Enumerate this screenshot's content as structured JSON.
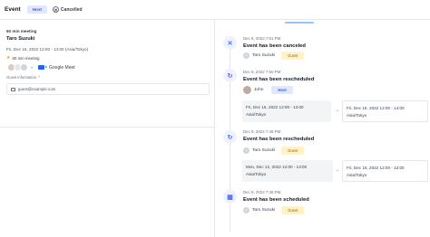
{
  "header": {
    "title": "Event",
    "badge": "Host",
    "status": "Cancelled",
    "status_icon": "cancel-circle-icon"
  },
  "details": {
    "event_name": "60 min meeting",
    "host": "Taro Suzuki",
    "time": "Fri, Dec 16, 2022 12:00 - 14:00 (Asia/Tokyo)",
    "duration": "60 min meeting",
    "location": "Google Meet",
    "guest_info_label": "Guest information",
    "guest_email": "guest@example.com"
  },
  "timeline": [
    {
      "icon": "close-icon",
      "date": "Dec 9, 2022 7:51 PM",
      "title": "Event has been canceled",
      "person": "Taro Suzuki",
      "role": "Guest"
    },
    {
      "icon": "reschedule-icon",
      "date": "Dec 9, 2022 7:50 PM",
      "title": "Event has been rescheduled",
      "person": "John",
      "role": "Host",
      "from": "Fri, Dec 16, 2022 12:00 - 13:00 · Asia/Tokyo",
      "to": "Fri, Dec 16, 2022 12:00 - 14:00 · Asia/Tokyo"
    },
    {
      "icon": "reschedule-icon",
      "date": "Dec 9, 2022 7:49 PM",
      "title": "Event has been rescheduled",
      "person": "Taro Suzuki",
      "role": "Guest",
      "from": "Mon, Dec 12, 2022 12:00 - 13:00 · Asia/Tokyo",
      "to": "Fri, Dec 16, 2022 12:00 - 13:00 · Asia/Tokyo"
    },
    {
      "icon": "calendar-icon",
      "date": "Dec 9, 2022 7:48 PM",
      "title": "Event has been scheduled",
      "person": "Taro Suzuki",
      "role": "Guest"
    }
  ],
  "colors": {
    "accent": "#3b5bdb",
    "guest_badge_bg": "#fef3c7",
    "host_badge_bg": "#e0e7ff"
  }
}
